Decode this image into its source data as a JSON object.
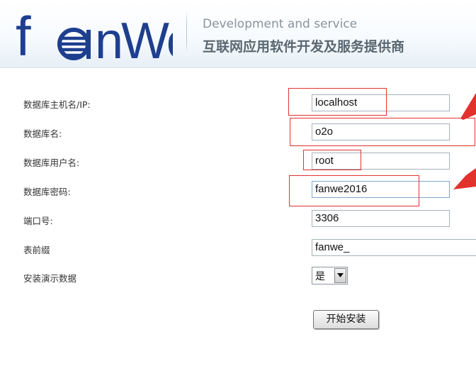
{
  "header": {
    "logo_text": "fanWe",
    "tagline_en": "Development and service",
    "tagline_zh": "互联网应用软件开发及服务提供商"
  },
  "form": {
    "fields": [
      {
        "label": "数据库主机名/IP:",
        "value": "localhost"
      },
      {
        "label": "数据库名:",
        "value": "o2o"
      },
      {
        "label": "数据库用户名:",
        "value": "root"
      },
      {
        "label": "数据库密码:",
        "value": "fanwe2016"
      },
      {
        "label": "端口号:",
        "value": "3306"
      },
      {
        "label": "表前缀",
        "value": "fanwe_"
      }
    ],
    "demo_data": {
      "label": "安装演示数据",
      "selected": "是"
    },
    "install_button": "开始安装"
  },
  "colors": {
    "annotation_red": "#e2322c",
    "logo_blue": "#1e3f8f",
    "text": "#333333",
    "input_border": "#a8b2bb"
  }
}
